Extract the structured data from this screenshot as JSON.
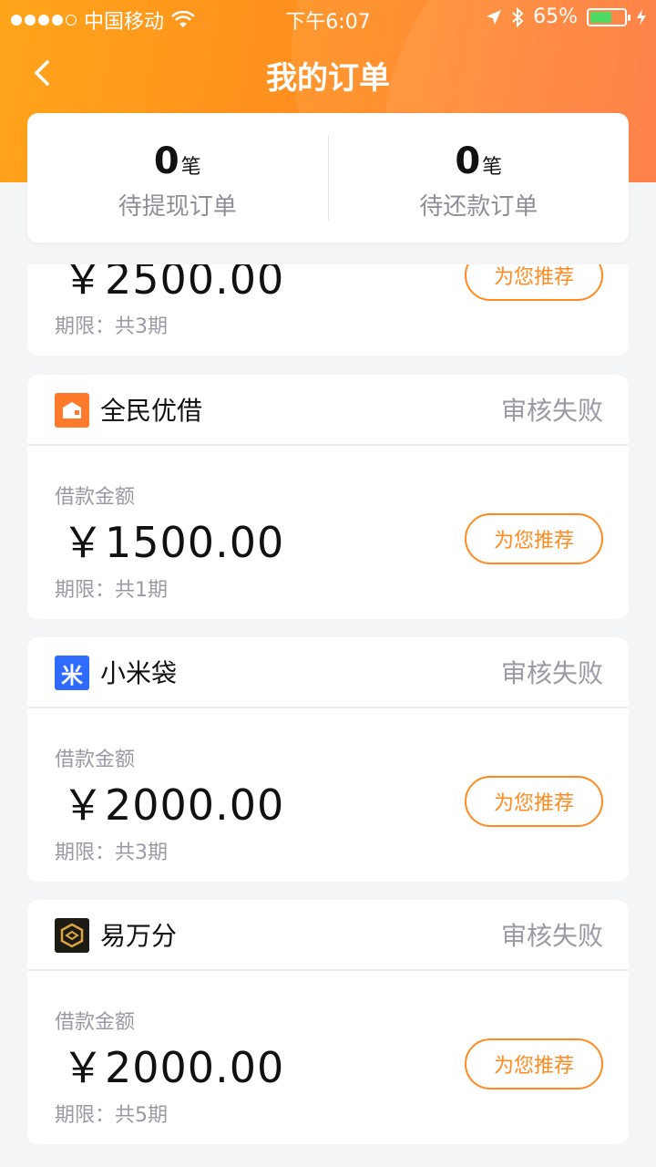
{
  "status_bar": {
    "carrier": "中国移动",
    "time": "下午6:07",
    "battery": "65%",
    "battery_level": 0.65
  },
  "nav": {
    "title": "我的订单"
  },
  "summary": {
    "unit": "笔",
    "pending_withdraw": {
      "count": "0",
      "label": "待提现订单"
    },
    "pending_repay": {
      "count": "0",
      "label": "待还款订单"
    }
  },
  "orders": [
    {
      "amount": "￥2500.00",
      "term": "期限：共3期",
      "button": "为您推荐"
    },
    {
      "name": "全民优借",
      "status": "审核失败",
      "amount_label": "借款金额",
      "amount": "￥1500.00",
      "term": "期限：共1期",
      "button": "为您推荐",
      "logo_color": "#ff7a2a"
    },
    {
      "name": "小米袋",
      "status": "审核失败",
      "amount_label": "借款金额",
      "amount": "￥2000.00",
      "term": "期限：共3期",
      "button": "为您推荐",
      "logo_color": "#2f6bff",
      "logo_text": "米"
    },
    {
      "name": "易万分",
      "status": "审核失败",
      "amount_label": "借款金额",
      "amount": "￥2000.00",
      "term": "期限：共5期",
      "button": "为您推荐",
      "logo_color": "#1e1a14"
    }
  ],
  "colors": {
    "brand_orange": "#ff8a1f",
    "status_gray": "#9a9aa6"
  }
}
